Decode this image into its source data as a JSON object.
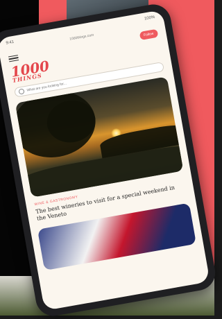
{
  "status_bar": {
    "time": "9:41",
    "battery": "100%"
  },
  "browser": {
    "url": "1000things.com"
  },
  "header": {
    "subscribe_label": "Follow"
  },
  "logo": {
    "number": "1000",
    "word": "THINGS"
  },
  "search": {
    "placeholder": "What are you looking for..."
  },
  "article": {
    "meta": "Wine & Gastronomy",
    "title": "The best wineries to visit for a special weekend in the Veneto"
  },
  "colors": {
    "accent": "#ef5b5f",
    "background": "#f05a5e",
    "screen": "#fbf6ee"
  }
}
